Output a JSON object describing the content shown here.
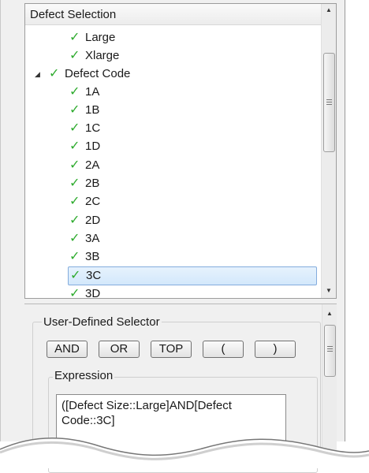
{
  "tree": {
    "header": "Defect Selection",
    "items": [
      {
        "label": "Large",
        "level": 1,
        "checked": true
      },
      {
        "label": "Xlarge",
        "level": 1,
        "checked": true
      },
      {
        "label": "Defect Code",
        "level": 0,
        "checked": true,
        "expanded": true
      },
      {
        "label": "1A",
        "level": 1,
        "checked": true
      },
      {
        "label": "1B",
        "level": 1,
        "checked": true
      },
      {
        "label": "1C",
        "level": 1,
        "checked": true
      },
      {
        "label": "1D",
        "level": 1,
        "checked": true
      },
      {
        "label": "2A",
        "level": 1,
        "checked": true
      },
      {
        "label": "2B",
        "level": 1,
        "checked": true
      },
      {
        "label": "2C",
        "level": 1,
        "checked": true
      },
      {
        "label": "2D",
        "level": 1,
        "checked": true
      },
      {
        "label": "3A",
        "level": 1,
        "checked": true
      },
      {
        "label": "3B",
        "level": 1,
        "checked": true
      },
      {
        "label": "3C",
        "level": 1,
        "checked": true,
        "selected": true
      },
      {
        "label": "3D",
        "level": 1,
        "checked": true
      }
    ]
  },
  "selector": {
    "title": "User-Defined Selector",
    "buttons": {
      "and": "AND",
      "or": "OR",
      "top": "TOP",
      "open_paren": "(",
      "close_paren": ")"
    },
    "expression_label": "Expression",
    "expression_value": "([Defect Size::Large]AND[Defect Code::3C]"
  },
  "colors": {
    "check": "#2eab2e",
    "selection_border": "#84acdd",
    "selection_fill": "#d3e8fb"
  },
  "icons": {
    "check": "check-icon",
    "expander": "expand-arrow-icon",
    "scroll_up": "scroll-up-arrow-icon",
    "scroll_down": "scroll-down-arrow-icon"
  }
}
